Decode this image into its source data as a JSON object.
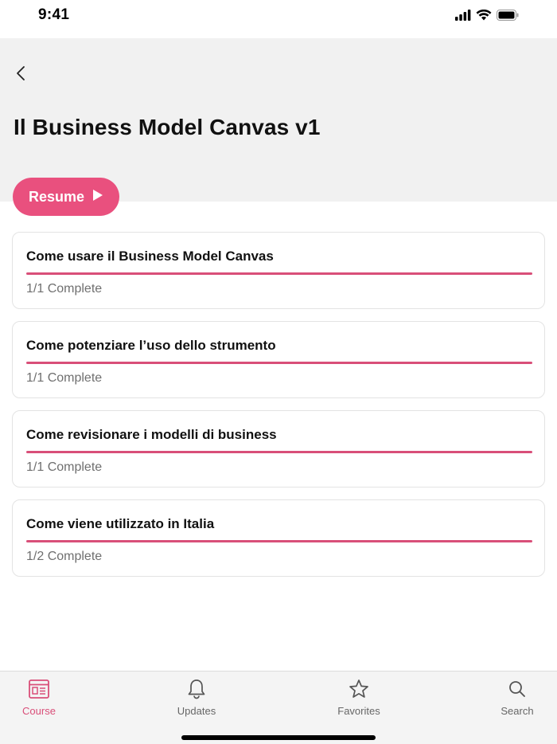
{
  "status_bar": {
    "time": "9:41"
  },
  "header": {
    "title": "Il Business Model Canvas v1",
    "back_icon": "chevron-left-icon"
  },
  "resume": {
    "label": "Resume",
    "icon": "play-icon",
    "color": "#e9507e"
  },
  "lessons": [
    {
      "title": "Come usare il Business Model Canvas",
      "status": "1/1 Complete",
      "progress": 1.0
    },
    {
      "title": "Come potenziare l’uso dello strumento",
      "status": "1/1 Complete",
      "progress": 1.0
    },
    {
      "title": "Come revisionare i modelli di business",
      "status": "1/1 Complete",
      "progress": 1.0
    },
    {
      "title": "Come viene utilizzato in Italia",
      "status": "1/2 Complete",
      "progress": 1.0
    }
  ],
  "tab_bar": {
    "tabs": [
      {
        "label": "Course",
        "icon": "course-icon",
        "active": true
      },
      {
        "label": "Updates",
        "icon": "bell-icon",
        "active": false
      },
      {
        "label": "Favorites",
        "icon": "star-icon",
        "active": false
      },
      {
        "label": "Search",
        "icon": "search-icon",
        "active": false
      }
    ]
  },
  "colors": {
    "accent": "#d94f79",
    "header_bg": "#f1f1f1"
  }
}
